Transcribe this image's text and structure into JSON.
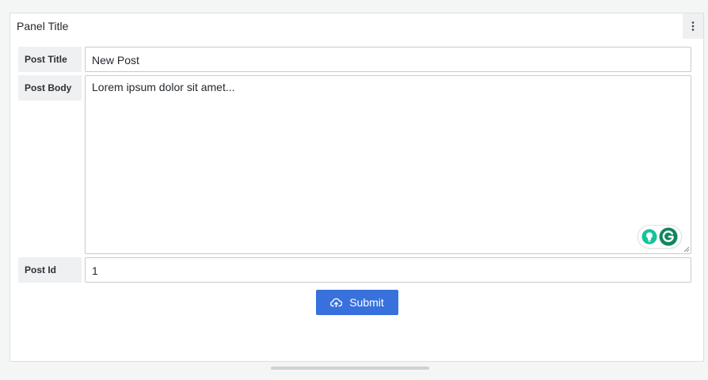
{
  "panel": {
    "title": "Panel Title",
    "menu_icon": "vertical-ellipsis-icon"
  },
  "form": {
    "fields": [
      {
        "label": "Post Title",
        "value": "New Post"
      },
      {
        "label": "Post Body",
        "value": "Lorem ipsum dolor sit amet..."
      },
      {
        "label": "Post Id",
        "value": "1"
      }
    ],
    "submit": {
      "label": "Submit",
      "icon": "cloud-upload-icon"
    }
  },
  "colors": {
    "accent": "#3871dc",
    "label_bg": "#eef0f1",
    "grammarly_teal": "#15c39a",
    "grammarly_green": "#11865e"
  }
}
